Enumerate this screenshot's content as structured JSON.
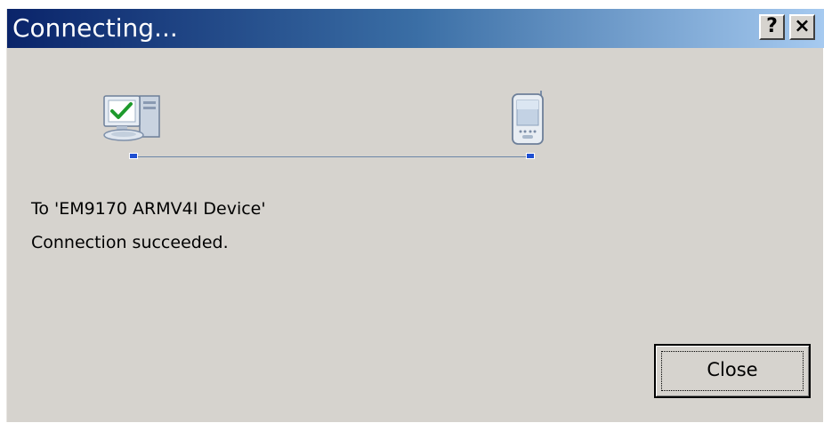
{
  "window": {
    "title": "Connecting...",
    "help_button": "?",
    "close_button": "×"
  },
  "connection": {
    "source_icon": "desktop-computer-icon",
    "target_icon": "pocket-pc-device-icon",
    "target_text": "To 'EM9170 ARMV4I Device'",
    "status_text": "Connection succeeded."
  },
  "actions": {
    "close_label": "Close"
  },
  "colors": {
    "titlebar_start": "#0a246a",
    "titlebar_end": "#a6caf0",
    "dialog_bg": "#d6d3ce",
    "node": "#1f4fd1"
  }
}
